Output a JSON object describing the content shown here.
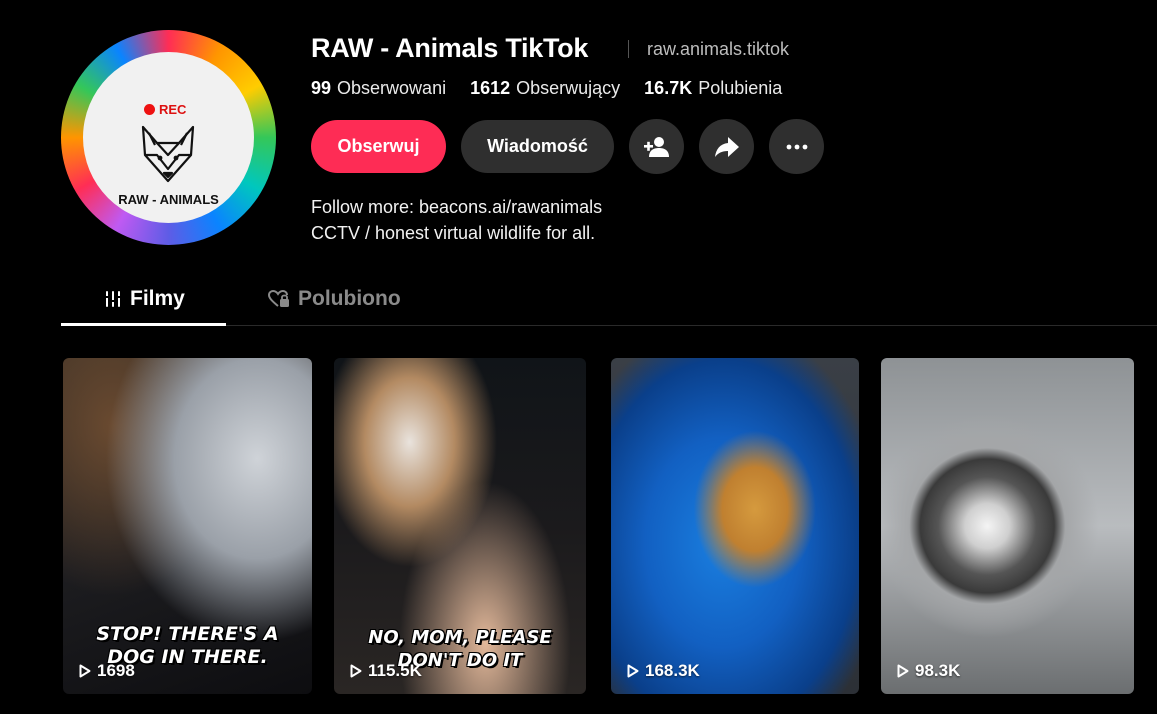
{
  "profile": {
    "display_name": "RAW - Animals TikTok",
    "handle": "raw.animals.tiktok",
    "avatar": {
      "rec_label": "REC",
      "name": "RAW - ANIMALS"
    },
    "stats": [
      {
        "value": "99",
        "label": "Obserwowani"
      },
      {
        "value": "1612",
        "label": "Obserwujący"
      },
      {
        "value": "16.7K",
        "label": "Polubienia"
      }
    ],
    "actions": {
      "follow": "Obserwuj",
      "message": "Wiadomość",
      "add_friend_icon": "add-user-icon",
      "share_icon": "share-icon",
      "more_icon": "more-icon"
    },
    "bio": {
      "line1": "Follow more: beacons.ai/rawanimals",
      "line2": "CCTV / honest virtual wildlife for all."
    }
  },
  "tabs": [
    {
      "label": "Filmy",
      "icon": "grid-icon",
      "active": true
    },
    {
      "label": "Polubiono",
      "icon": "heart-lock-icon",
      "active": false
    }
  ],
  "videos": [
    {
      "caption_line1": "STOP! THERE'S A",
      "caption_line2": "DOG IN THERE.",
      "views": "1698"
    },
    {
      "caption_line1": "NO, MOM, PLEASE",
      "caption_line2": "DON'T DO IT",
      "views": "115.5K"
    },
    {
      "caption_line1": "",
      "caption_line2": "",
      "views": "168.3K"
    },
    {
      "caption_line1": "",
      "caption_line2": "",
      "views": "98.3K"
    }
  ],
  "colors": {
    "accent": "#fe2c55",
    "background": "#000000",
    "button_dark": "#2f2f2f"
  }
}
